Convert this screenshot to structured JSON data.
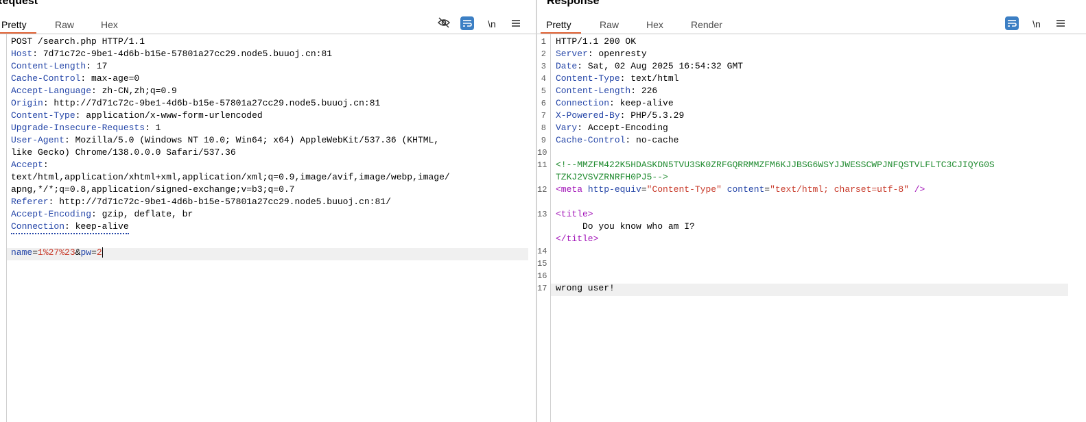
{
  "request": {
    "title": "Request",
    "tabs": [
      "Pretty",
      "Raw",
      "Hex"
    ],
    "active_tab": "Pretty",
    "toolbar": {
      "newline_label": "\\n"
    },
    "lines": {
      "l1": "POST /search.php HTTP/1.1",
      "l2k": "Host",
      "l2v": ": 7d71c72c-9be1-4d6b-b15e-57801a27cc29.node5.buuoj.cn:81",
      "l3k": "Content-Length",
      "l3v": ": 17",
      "l4k": "Cache-Control",
      "l4v": ": max-age=0",
      "l5k": "Accept-Language",
      "l5v": ": zh-CN,zh;q=0.9",
      "l6k": "Origin",
      "l6v": ": http://7d71c72c-9be1-4d6b-b15e-57801a27cc29.node5.buuoj.cn:81",
      "l7k": "Content-Type",
      "l7v": ": application/x-www-form-urlencoded",
      "l8k": "Upgrade-Insecure-Requests",
      "l8v": ": 1",
      "l9k": "User-Agent",
      "l9v": ": Mozilla/5.0 (Windows NT 10.0; Win64; x64) AppleWebKit/537.36 (KHTML,",
      "l9b": "like Gecko) Chrome/138.0.0.0 Safari/537.36",
      "l10k": "Accept",
      "l10v": ":",
      "l10b": "text/html,application/xhtml+xml,application/xml;q=0.9,image/avif,image/webp,image/",
      "l10c": "apng,*/*;q=0.8,application/signed-exchange;v=b3;q=0.7",
      "l11k": "Referer",
      "l11v": ": http://7d71c72c-9be1-4d6b-b15e-57801a27cc29.node5.buuoj.cn:81/",
      "l12k": "Accept-Encoding",
      "l12v": ": gzip, deflate, br",
      "l13k": "Connection",
      "l13v": ": keep-alive",
      "body_k1": "name",
      "body_eq1": "=",
      "body_v1": "1%27%23",
      "body_amp": "&",
      "body_k2": "pw",
      "body_eq2": "=",
      "body_v2": "2"
    }
  },
  "response": {
    "title": "Response",
    "tabs": [
      "Pretty",
      "Raw",
      "Hex",
      "Render"
    ],
    "active_tab": "Pretty",
    "toolbar": {
      "newline_label": "\\n"
    },
    "line_numbers": [
      "1",
      "2",
      "3",
      "4",
      "5",
      "6",
      "7",
      "8",
      "9",
      "10",
      "11",
      "12",
      "13",
      "14",
      "15",
      "16",
      "17"
    ],
    "lines": {
      "l1": "HTTP/1.1 200 OK",
      "l2k": "Server",
      "l2v": ": openresty",
      "l3k": "Date",
      "l3v": ": Sat, 02 Aug 2025 16:54:32 GMT",
      "l4k": "Content-Type",
      "l4v": ": text/html",
      "l5k": "Content-Length",
      "l5v": ": 226",
      "l6k": "Connection",
      "l6v": ": keep-alive",
      "l7k": "X-Powered-By",
      "l7v": ": PHP/5.3.29",
      "l8k": "Vary",
      "l8v": ": Accept-Encoding",
      "l9k": "Cache-Control",
      "l9v": ": no-cache",
      "l11a": "<!--MMZFM422K5HDASKDN5TVU3SK0ZRFGQRRMMZFM6KJJBSG6WSYJJWESSCWPJNFQSTVLFLTC3CJIQYG0S",
      "l11b": "TZKJ2VSVZRNRFH0PJ5-->",
      "l12_open": "<meta",
      "l12_a1": "http-equiv",
      "l12_v1": "\"Content-Type\"",
      "l12_a2": "content",
      "l12_v2": "\"text/html; charset=utf-8\"",
      "l12_close": " />",
      "l13_open": "<title>",
      "l13_text": "     Do you know who am I?",
      "l13_close": "</title>",
      "l17": "wrong user!"
    }
  }
}
